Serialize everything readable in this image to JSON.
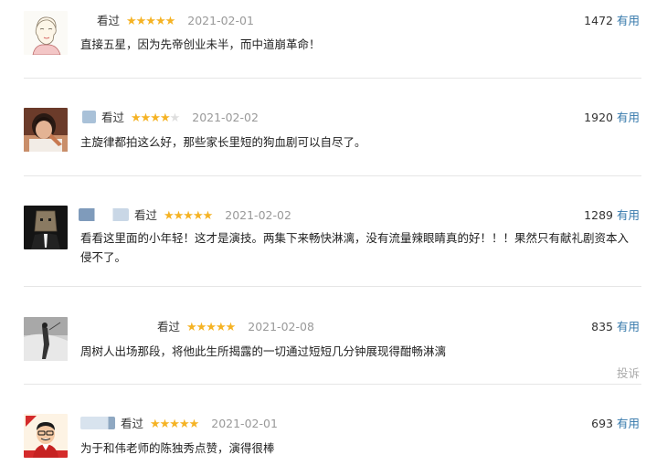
{
  "reviews": [
    {
      "avatar": "sketch-portrait-avatar",
      "status": "看过",
      "rating": 5,
      "stars": "★★★★★",
      "date": "2021-02-01",
      "votes": "1472",
      "useful_label": "有用",
      "text": "直接五星，因为先帝创业未半，而中道崩革命！"
    },
    {
      "avatar": "woman-photo-avatar",
      "status": "看过",
      "rating": 4,
      "stars": "★★★★",
      "star_off": "★",
      "date": "2021-02-02",
      "votes": "1920",
      "useful_label": "有用",
      "text": "主旋律都拍这么好，那些家长里短的狗血剧可以自尽了。"
    },
    {
      "avatar": "bag-head-avatar",
      "status": "看过",
      "rating": 5,
      "stars": "★★★★★",
      "date": "2021-02-02",
      "votes": "1289",
      "useful_label": "有用",
      "text": "看看这里面的小年轻！这才是演技。两集下来畅快淋漓，没有流量辣眼睛真的好！！！果然只有献礼剧资本入侵不了。"
    },
    {
      "avatar": "bw-figure-avatar",
      "status": "看过",
      "rating": 5,
      "stars": "★★★★★",
      "date": "2021-02-08",
      "votes": "835",
      "useful_label": "有用",
      "text": "周树人出场那段，将他此生所揭露的一切通过短短几分钟展现得酣畅淋漓",
      "report_label": "投诉"
    },
    {
      "avatar": "cartoon-man-avatar",
      "status": "看过",
      "rating": 5,
      "stars": "★★★★★",
      "date": "2021-02-01",
      "votes": "693",
      "useful_label": "有用",
      "text": "为于和伟老师的陈独秀点赞，演得很棒"
    }
  ],
  "colors": {
    "star": "#f5b324",
    "link": "#3377aa",
    "date": "#999999",
    "divider": "#e6e6e6"
  }
}
